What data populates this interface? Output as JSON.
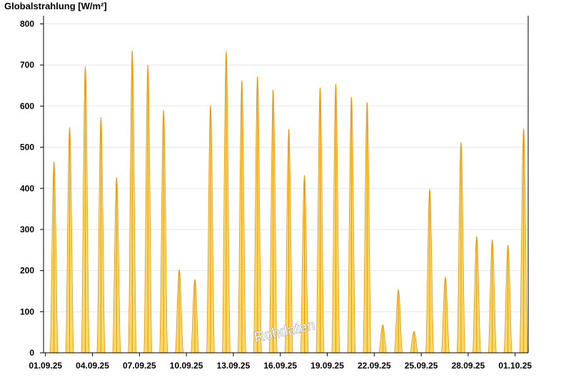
{
  "chart_data": {
    "type": "area",
    "title": "Globalstrahlung [W/m²]",
    "ylim": [
      0,
      820
    ],
    "yticks": [
      0,
      100,
      200,
      300,
      400,
      500,
      600,
      700,
      800
    ],
    "xlim": [
      "2025-08-31T21:00",
      "2025-10-01T20:00"
    ],
    "xticks": [
      {
        "date": "2025-09-01",
        "label": "01.09.25"
      },
      {
        "date": "2025-09-04",
        "label": "04.09.25"
      },
      {
        "date": "2025-09-07",
        "label": "07.09.25"
      },
      {
        "date": "2025-09-10",
        "label": "10.09.25"
      },
      {
        "date": "2025-09-13",
        "label": "13.09.25"
      },
      {
        "date": "2025-09-16",
        "label": "16.09.25"
      },
      {
        "date": "2025-09-19",
        "label": "19.09.25"
      },
      {
        "date": "2025-09-22",
        "label": "22.09.25"
      },
      {
        "date": "2025-09-25",
        "label": "25.09.25"
      },
      {
        "date": "2025-09-28",
        "label": "28.09.25"
      },
      {
        "date": "2025-10-01",
        "label": "01.10.25"
      }
    ],
    "grid": true,
    "daily_peaks": [
      {
        "date": "2025-09-01",
        "peak": 465
      },
      {
        "date": "2025-09-02",
        "peak": 548
      },
      {
        "date": "2025-09-03",
        "peak": 697
      },
      {
        "date": "2025-09-04",
        "peak": 573
      },
      {
        "date": "2025-09-05",
        "peak": 427
      },
      {
        "date": "2025-09-06",
        "peak": 735
      },
      {
        "date": "2025-09-07",
        "peak": 700
      },
      {
        "date": "2025-09-08",
        "peak": 590
      },
      {
        "date": "2025-09-09",
        "peak": 202
      },
      {
        "date": "2025-09-10",
        "peak": 178
      },
      {
        "date": "2025-09-11",
        "peak": 602
      },
      {
        "date": "2025-09-12",
        "peak": 733
      },
      {
        "date": "2025-09-13",
        "peak": 662
      },
      {
        "date": "2025-09-14",
        "peak": 672
      },
      {
        "date": "2025-09-15",
        "peak": 640
      },
      {
        "date": "2025-09-16",
        "peak": 544
      },
      {
        "date": "2025-09-17",
        "peak": 432
      },
      {
        "date": "2025-09-18",
        "peak": 645
      },
      {
        "date": "2025-09-19",
        "peak": 654
      },
      {
        "date": "2025-09-20",
        "peak": 622
      },
      {
        "date": "2025-09-21",
        "peak": 609
      },
      {
        "date": "2025-09-22",
        "peak": 68
      },
      {
        "date": "2025-09-23",
        "peak": 153
      },
      {
        "date": "2025-09-24",
        "peak": 52
      },
      {
        "date": "2025-09-25",
        "peak": 398
      },
      {
        "date": "2025-09-26",
        "peak": 184
      },
      {
        "date": "2025-09-27",
        "peak": 512
      },
      {
        "date": "2025-09-28",
        "peak": 283
      },
      {
        "date": "2025-09-29",
        "peak": 275
      },
      {
        "date": "2025-09-30",
        "peak": 262
      },
      {
        "date": "2025-10-01",
        "peak": 545
      }
    ]
  },
  "watermark": "Rohdaten",
  "colors": {
    "fill": "#ffd966",
    "stroke": "#e8960a",
    "grid": "#e6e6e6",
    "axis": "#000000"
  }
}
